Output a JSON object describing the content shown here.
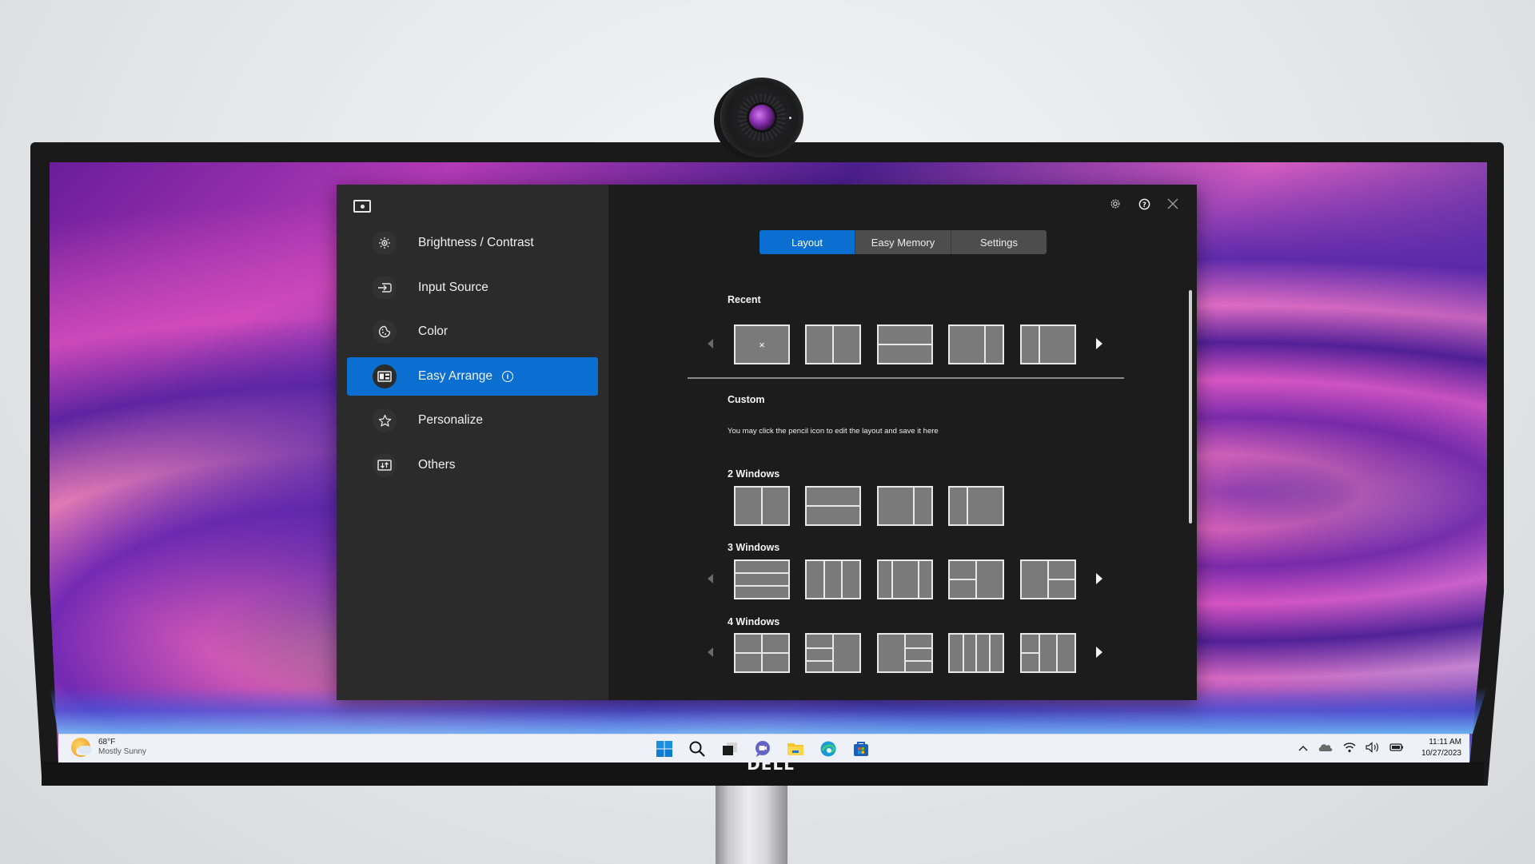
{
  "app": {
    "sidebar": {
      "items": [
        {
          "label": "Brightness / Contrast",
          "icon": "brightness-icon",
          "active": false
        },
        {
          "label": "Input Source",
          "icon": "input-source-icon",
          "active": false
        },
        {
          "label": "Color",
          "icon": "palette-icon",
          "active": false
        },
        {
          "label": "Easy Arrange",
          "icon": "layout-icon",
          "active": true,
          "info": "i"
        },
        {
          "label": "Personalize",
          "icon": "star-icon",
          "active": false
        },
        {
          "label": "Others",
          "icon": "others-icon",
          "active": false
        }
      ]
    },
    "window_controls": [
      "gear-icon",
      "help-icon",
      "close-icon"
    ],
    "tabs": [
      {
        "label": "Layout",
        "active": true
      },
      {
        "label": "Easy Memory",
        "active": false
      },
      {
        "label": "Settings",
        "active": false
      }
    ],
    "recent": {
      "title": "Recent",
      "layouts": [
        "empty",
        "2-vertical-equal",
        "2-horizontal-equal",
        "2-vertical-left-wide",
        "2-vertical-right-wide"
      ],
      "empty_mark": "×"
    },
    "custom": {
      "title": "Custom",
      "help": "You may click the pencil icon to edit the layout and save it here"
    },
    "groups": [
      {
        "title": "2 Windows",
        "layouts": [
          "2-vertical-equal",
          "2-horizontal-equal",
          "2-vertical-left-wide",
          "2-vertical-right-wide"
        ],
        "has_arrows": false
      },
      {
        "title": "3 Windows",
        "layouts": [
          "3-horizontal-rows",
          "3-vertical-equal",
          "3-vertical-center-wide",
          "3-left-split-right-full",
          "3-left-full-right-split"
        ],
        "has_arrows": true
      },
      {
        "title": "4 Windows",
        "layouts": [
          "4-quad",
          "4-left-3-stack-right-full",
          "4-left-full-right-3-stack",
          "4-vertical-columns",
          "4-left-split-two-columns"
        ],
        "has_arrows": true
      }
    ],
    "accent_color": "#0a6fd0"
  },
  "taskbar": {
    "weather": {
      "temp": "68°F",
      "desc": "Mostly Sunny"
    },
    "pinned": [
      "windows-start-icon",
      "search-icon",
      "task-view-icon",
      "teams-chat-icon",
      "file-explorer-icon",
      "edge-icon",
      "store-icon"
    ],
    "tray": [
      "chevron-up-icon",
      "onedrive-icon",
      "wifi-icon",
      "volume-icon",
      "battery-icon"
    ],
    "time": "11:11 AM",
    "date": "10/27/2023"
  },
  "monitor": {
    "brand": "DELL"
  }
}
